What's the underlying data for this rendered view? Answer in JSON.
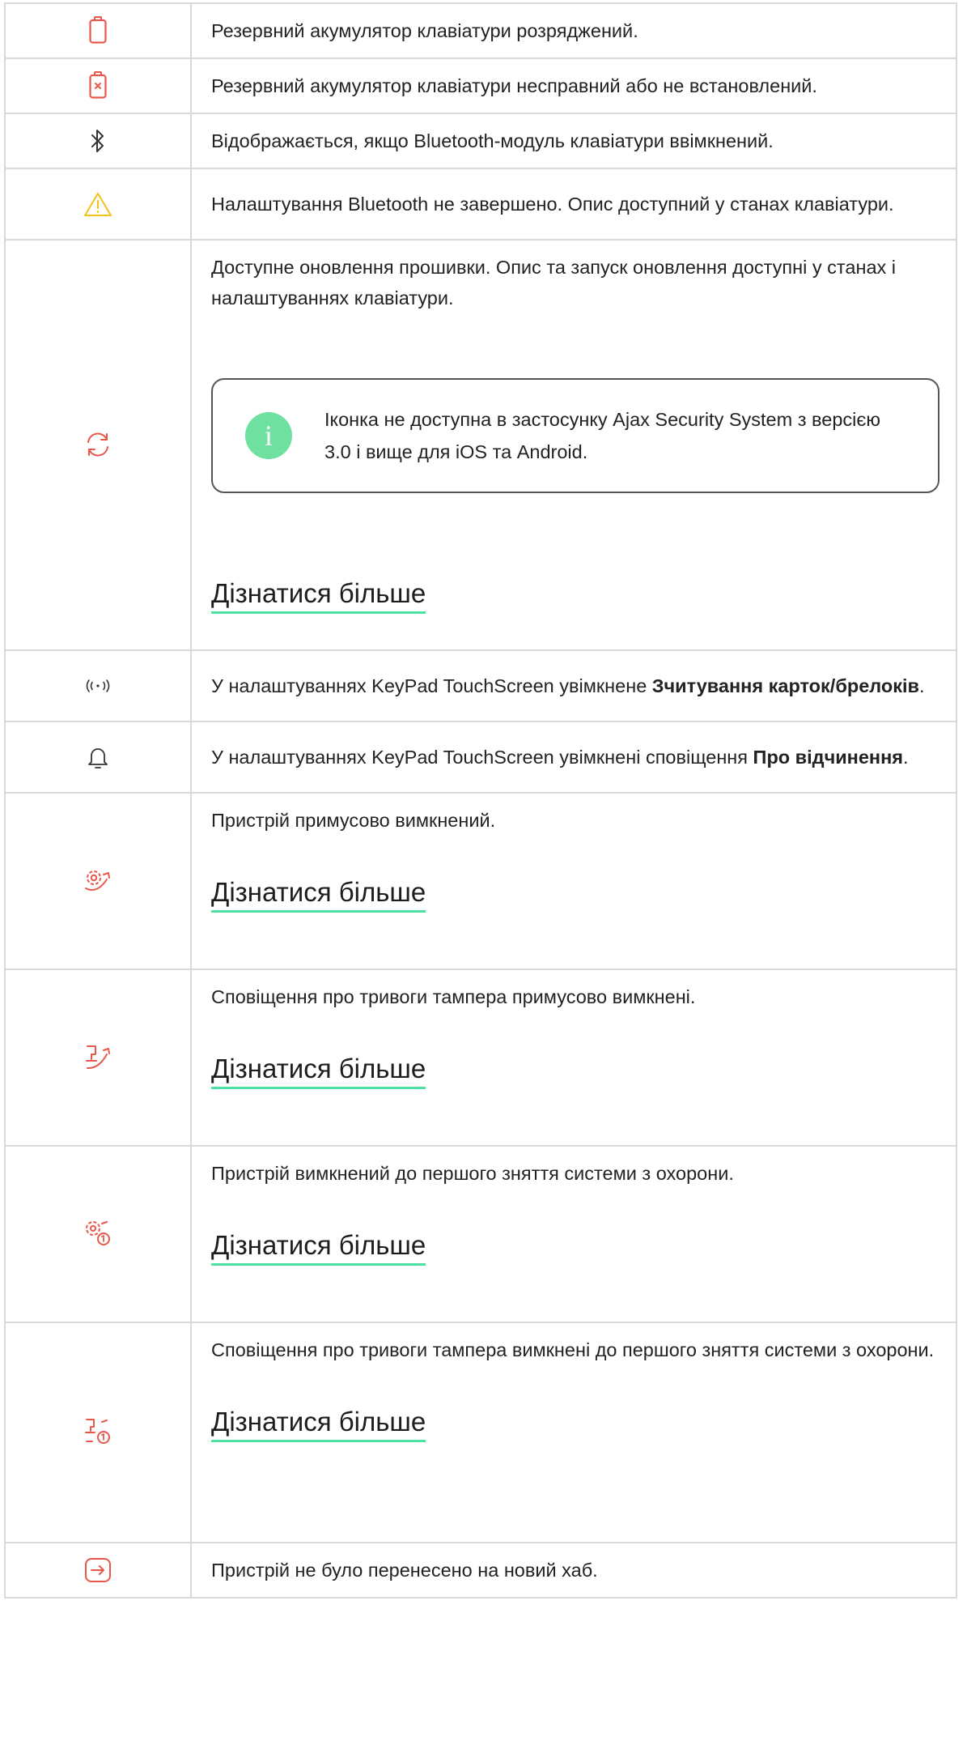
{
  "rows": [
    {
      "icon": "battery-empty-icon",
      "text": "Резервний акумулятор клавіатури розряджений."
    },
    {
      "icon": "battery-fault-icon",
      "text": "Резервний акумулятор клавіатури несправний або не встановлений."
    },
    {
      "icon": "bluetooth-icon",
      "text": "Відображається, якщо Bluetooth-модуль клавіатури ввімкнений."
    },
    {
      "icon": "warning-triangle-icon",
      "text": "Налаштування Bluetooth не завершено. Опис доступний у станах клавіатури."
    },
    {
      "icon": "firmware-update-icon",
      "text": "Доступне оновлення прошивки. Опис та запуск оновлення доступні у станах і налаштуваннях клавіатури.",
      "note": "Іконка не доступна в застосунку Ajax Security System з версією 3.0 і вище для iOS та Android.",
      "note_badge": "i",
      "link": "Дізнатися більше"
    },
    {
      "icon": "card-reading-icon",
      "text_before": "У налаштуваннях KeyPad TouchScreen увімкнене ",
      "text_bold": "Зчитування карток/брелоків",
      "text_after": "."
    },
    {
      "icon": "bell-icon",
      "text_before": "У налаштуваннях KeyPad TouchScreen увімкнені сповіщення ",
      "text_bold": "Про відчинення",
      "text_after": "."
    },
    {
      "icon": "device-forced-off-icon",
      "text": "Пристрій примусово вимкнений.",
      "link": "Дізнатися більше"
    },
    {
      "icon": "tamper-forced-off-icon",
      "text": "Сповіщення про тривоги тампера примусово вимкнені.",
      "link": "Дізнатися більше"
    },
    {
      "icon": "device-off-until-disarm-icon",
      "text": "Пристрій вимкнений до першого зняття системи з охорони.",
      "link": "Дізнатися більше"
    },
    {
      "icon": "tamper-off-until-disarm-icon",
      "text": "Сповіщення про тривоги тампера вимкнені до першого зняття системи з охорони.",
      "link": "Дізнатися більше"
    },
    {
      "icon": "transfer-icon",
      "text": "Пристрій не було перенесено на новий хаб."
    }
  ],
  "colors": {
    "icon_red": "#e8584a",
    "warning_yellow": "#f2c21a",
    "icon_dark": "#333333",
    "link_underline": "#4fe0a4",
    "note_badge": "#6ee0a0",
    "border": "#d9d9d9"
  }
}
